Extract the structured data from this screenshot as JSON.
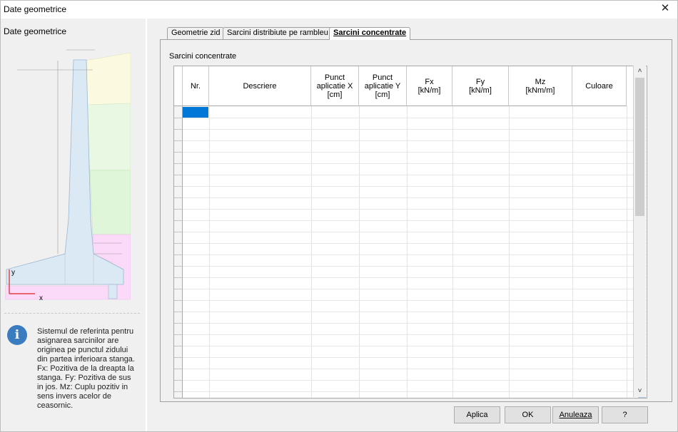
{
  "window": {
    "title": "Date geometrice",
    "close_glyph": "✕"
  },
  "left_panel": {
    "title": "Date geometrice",
    "axis_x": "x",
    "axis_y": "y",
    "info_glyph": "i",
    "info_text": "Sistemul de referinta pentru asignarea sarcinilor are originea pe punctul zidului din partea inferioara stanga. Fx: Pozitiva de la dreapta la stanga. Fy: Pozitiva de sus in jos. Mz: Cuplu pozitiv in sens invers acelor de ceasornic."
  },
  "tabs": [
    {
      "label": "Geometrie zid",
      "active": false
    },
    {
      "label": "Sarcini distribiute pe rambleu",
      "active": false
    },
    {
      "label": "Sarcini concentrate",
      "active": true
    }
  ],
  "section_label": "Sarcini concentrate",
  "table": {
    "columns": [
      {
        "key": "nr",
        "label": "Nr."
      },
      {
        "key": "descriere",
        "label": "Descriere"
      },
      {
        "key": "px",
        "label": "Punct\naplicatie X\n[cm]"
      },
      {
        "key": "py",
        "label": "Punct\naplicatie Y\n[cm]"
      },
      {
        "key": "fx",
        "label": "Fx\n[kN/m]"
      },
      {
        "key": "fy",
        "label": "Fy\n[kN/m]"
      },
      {
        "key": "mz",
        "label": "Mz\n[kNm/m]"
      },
      {
        "key": "culoare",
        "label": "Culoare"
      }
    ],
    "rows": []
  },
  "scroll": {
    "up": "˄",
    "down": "˅"
  },
  "buttons": {
    "aplica": "Aplica",
    "ok": "OK",
    "anuleaza": "Anuleaza",
    "help": "?"
  }
}
